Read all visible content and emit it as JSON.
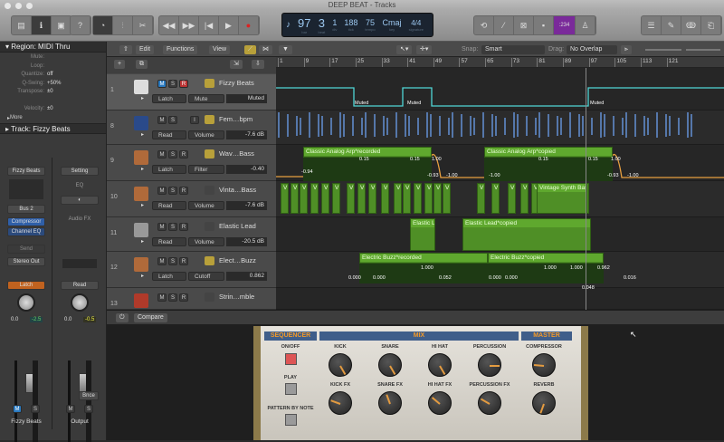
{
  "window": {
    "title": "DEEP BEAT - Tracks"
  },
  "lcd": {
    "bar": "97",
    "beat": "3",
    "div": "1",
    "tick": "188",
    "tempo": "75",
    "key": "Cmaj",
    "signature": "4/4",
    "labels": {
      "bar": "bar",
      "beat": "beat",
      "div": "div",
      "tick": "tick",
      "tempo": "tempo",
      "key": "key",
      "signature": "signature"
    }
  },
  "toolbar": {
    "cpu_counter": ":234",
    "accent": "#7a2a9a"
  },
  "inspector": {
    "region_header": "Region: MIDI Thru",
    "params": [
      {
        "k": "Mute:",
        "v": ""
      },
      {
        "k": "Loop:",
        "v": ""
      },
      {
        "k": "Quantize:",
        "v": "off"
      },
      {
        "k": "Q-Swing:",
        "v": "+50%"
      },
      {
        "k": "Transpose:",
        "v": "±0"
      },
      {
        "k": "",
        "v": ""
      },
      {
        "k": "Velocity:",
        "v": "±0"
      }
    ],
    "more": "More",
    "track_header": "Track: Fizzy Beats",
    "strip1": {
      "name_top": "Fizzy Beats",
      "bus": "Bus 2",
      "fx1": "Compressor",
      "fx2": "Channel EQ",
      "send": "Send",
      "output": "Stereo Out",
      "automation": "Latch",
      "vol": "0.0",
      "peak": "-2.5",
      "m": "M",
      "s": "S",
      "name": "Fizzy Beats"
    },
    "strip2": {
      "setting": "Setting",
      "eq": "EQ",
      "audiofx": "Audio FX",
      "automation": "Read",
      "vol": "0.0",
      "peak": "-0.5",
      "bnce": "Bnce",
      "m": "M",
      "s": "S",
      "name": "Output"
    }
  },
  "tracksbar": {
    "edit": "Edit",
    "functions": "Functions",
    "view": "View",
    "snap_label": "Snap:",
    "snap": "Smart",
    "drag_label": "Drag:",
    "drag": "No Overlap"
  },
  "ruler": [
    "1",
    "9",
    "17",
    "25",
    "33",
    "41",
    "49",
    "57",
    "65",
    "73",
    "81",
    "89",
    "97",
    "105",
    "113",
    "121"
  ],
  "tracks": [
    {
      "num": "1",
      "name": "Fizzy Beats",
      "mode": "Latch",
      "param": "Mute",
      "value": "Muted",
      "m": "M",
      "s": "S",
      "r": "R"
    },
    {
      "num": "8",
      "name": "Fem…bpm",
      "mode": "Read",
      "param": "Volume",
      "value": "-7.6 dB",
      "m": "M",
      "s": "S",
      "r": "I"
    },
    {
      "num": "9",
      "name": "Wav…Bass",
      "mode": "Latch",
      "param": "Filter",
      "value": "-0.40",
      "m": "M",
      "s": "S",
      "r": "R"
    },
    {
      "num": "10",
      "name": "Vinta…Bass",
      "mode": "Read",
      "param": "Volume",
      "value": "-7.6 dB",
      "m": "M",
      "s": "S",
      "r": "R"
    },
    {
      "num": "11",
      "name": "Elastic Lead",
      "mode": "Read",
      "param": "Volume",
      "value": "-20.5 dB",
      "m": "M",
      "s": "S",
      "r": "R"
    },
    {
      "num": "12",
      "name": "Elect…Buzz",
      "mode": "Latch",
      "param": "Cutoff",
      "value": "0.862",
      "m": "M",
      "s": "S",
      "r": "R"
    },
    {
      "num": "13",
      "name": "Strin…mble",
      "m": "M",
      "s": "S",
      "r": "R"
    }
  ],
  "regions": {
    "muted": [
      "Muted",
      "Muted",
      "Muted"
    ],
    "arp": [
      "Classic Analog Arp*recorded",
      "Classic Analog Arp*copied"
    ],
    "arp_points": [
      "-0.94",
      "0.15",
      "0.15",
      "1.00",
      "-0.93",
      "-1.00",
      "-1.00",
      "0.15",
      "0.15",
      "1.00",
      "-0.93",
      "-1.00"
    ],
    "vintage": "Vintage Synth Bas",
    "v": "V",
    "elastic": [
      "Elastic L",
      "Elastic Lead*copied"
    ],
    "buzz": [
      "Electric Buzz*recorded",
      "Electric Buzz*copied"
    ],
    "buzz_points": [
      "0.000",
      "0.000",
      "1.000",
      "0.052",
      "0.000",
      "0.000",
      "1.000",
      "1.000",
      "0.962",
      "0.048",
      "0.016"
    ]
  },
  "bottom": {
    "compare": "Compare"
  },
  "plugin": {
    "sequencer": "SEQUENCER",
    "mix": "MIX",
    "master": "MASTER",
    "onoff": "ON/OFF",
    "play": "PLAY",
    "pattern": "PATTERN BY NOTE",
    "knobs": [
      "KICK",
      "SNARE",
      "HI HAT",
      "PERCUSSION",
      "KICK FX",
      "SNARE FX",
      "HI HAT FX",
      "PERCUSSION FX"
    ],
    "master_knobs": [
      "COMPRESSOR",
      "REVERB"
    ]
  }
}
